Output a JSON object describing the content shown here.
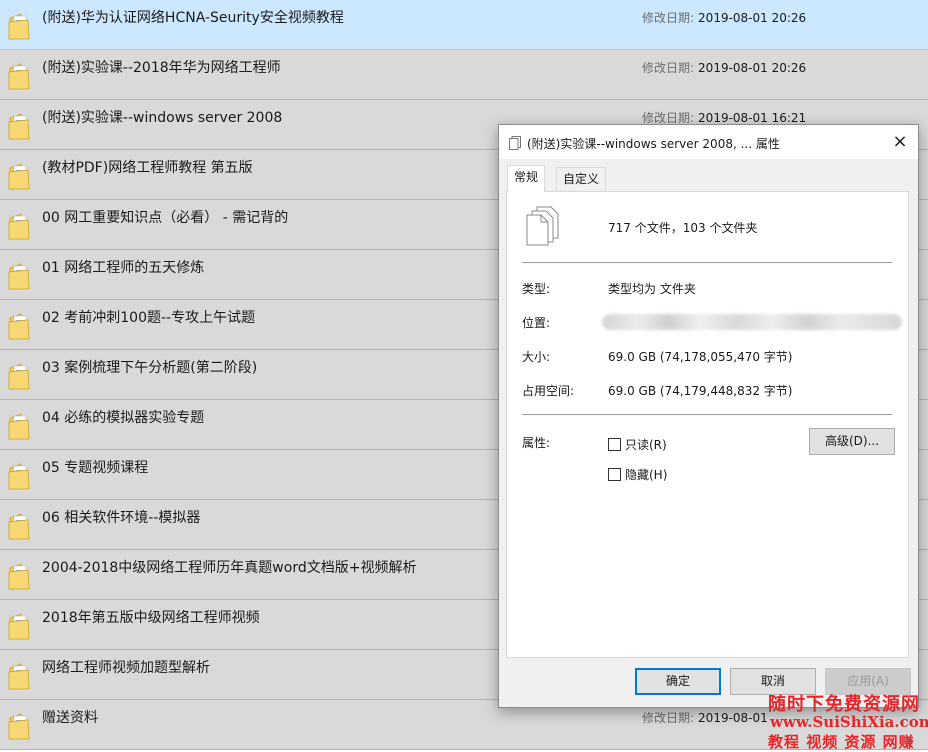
{
  "file_list": {
    "date_label": "修改日期:",
    "items": [
      {
        "name": "(附送)华为认证网络HCNA-Seurity安全视频教程",
        "date": "2019-08-01 20:26",
        "selected": true
      },
      {
        "name": "(附送)实验课--2018年华为网络工程师",
        "date": "2019-08-01 20:26"
      },
      {
        "name": "(附送)实验课--windows server 2008",
        "date": "2019-08-01 16:21"
      },
      {
        "name": "(教材PDF)网络工程师教程 第五版"
      },
      {
        "name": "00 网工重要知识点（必看） - 需记背的"
      },
      {
        "name": "01 网络工程师的五天修炼"
      },
      {
        "name": "02 考前冲刺100题--专攻上午试题"
      },
      {
        "name": "03 案例梳理下午分析题(第二阶段)"
      },
      {
        "name": "04 必练的模拟器实验专题"
      },
      {
        "name": "05 专题视频课程"
      },
      {
        "name": "06 相关软件环境--模拟器"
      },
      {
        "name": "2004-2018中级网络工程师历年真题word文档版+视频解析"
      },
      {
        "name": "2018年第五版中级网络工程师视频"
      },
      {
        "name": "网络工程师视频加题型解析"
      },
      {
        "name": "赠送资料",
        "date": "2019-08-01"
      }
    ]
  },
  "dialog": {
    "title": "(附送)实验课--windows server 2008, ... 属性",
    "close": "×",
    "tabs": [
      {
        "label": "常规",
        "active": true
      },
      {
        "label": "自定义"
      }
    ],
    "summary": "717 个文件，103 个文件夹",
    "type_label": "类型:",
    "type_value": "类型均为 文件夹",
    "location_label": "位置:",
    "size_label": "大小:",
    "size_value": "69.0 GB (74,178,055,470 字节)",
    "disk_label": "占用空间:",
    "disk_value": "69.0 GB (74,179,448,832 字节)",
    "attr_label": "属性:",
    "readonly_label": "只读(R)",
    "hidden_label": "隐藏(H)",
    "advanced_label": "高级(D)...",
    "ok_label": "确定",
    "cancel_label": "取消",
    "apply_label": "应用(A)"
  },
  "watermark": {
    "line1": "随时下免费资源网",
    "line2": "www.SuiShiXia.com",
    "line3": "教程 视频 资源 网赚"
  },
  "colors": {
    "row_bg": "#d9d9d9",
    "row_selected_bg": "#cce8ff",
    "folder_yellow": "#f3c94f",
    "accent_blue": "#0078d7",
    "watermark_red": "#e8262a"
  }
}
